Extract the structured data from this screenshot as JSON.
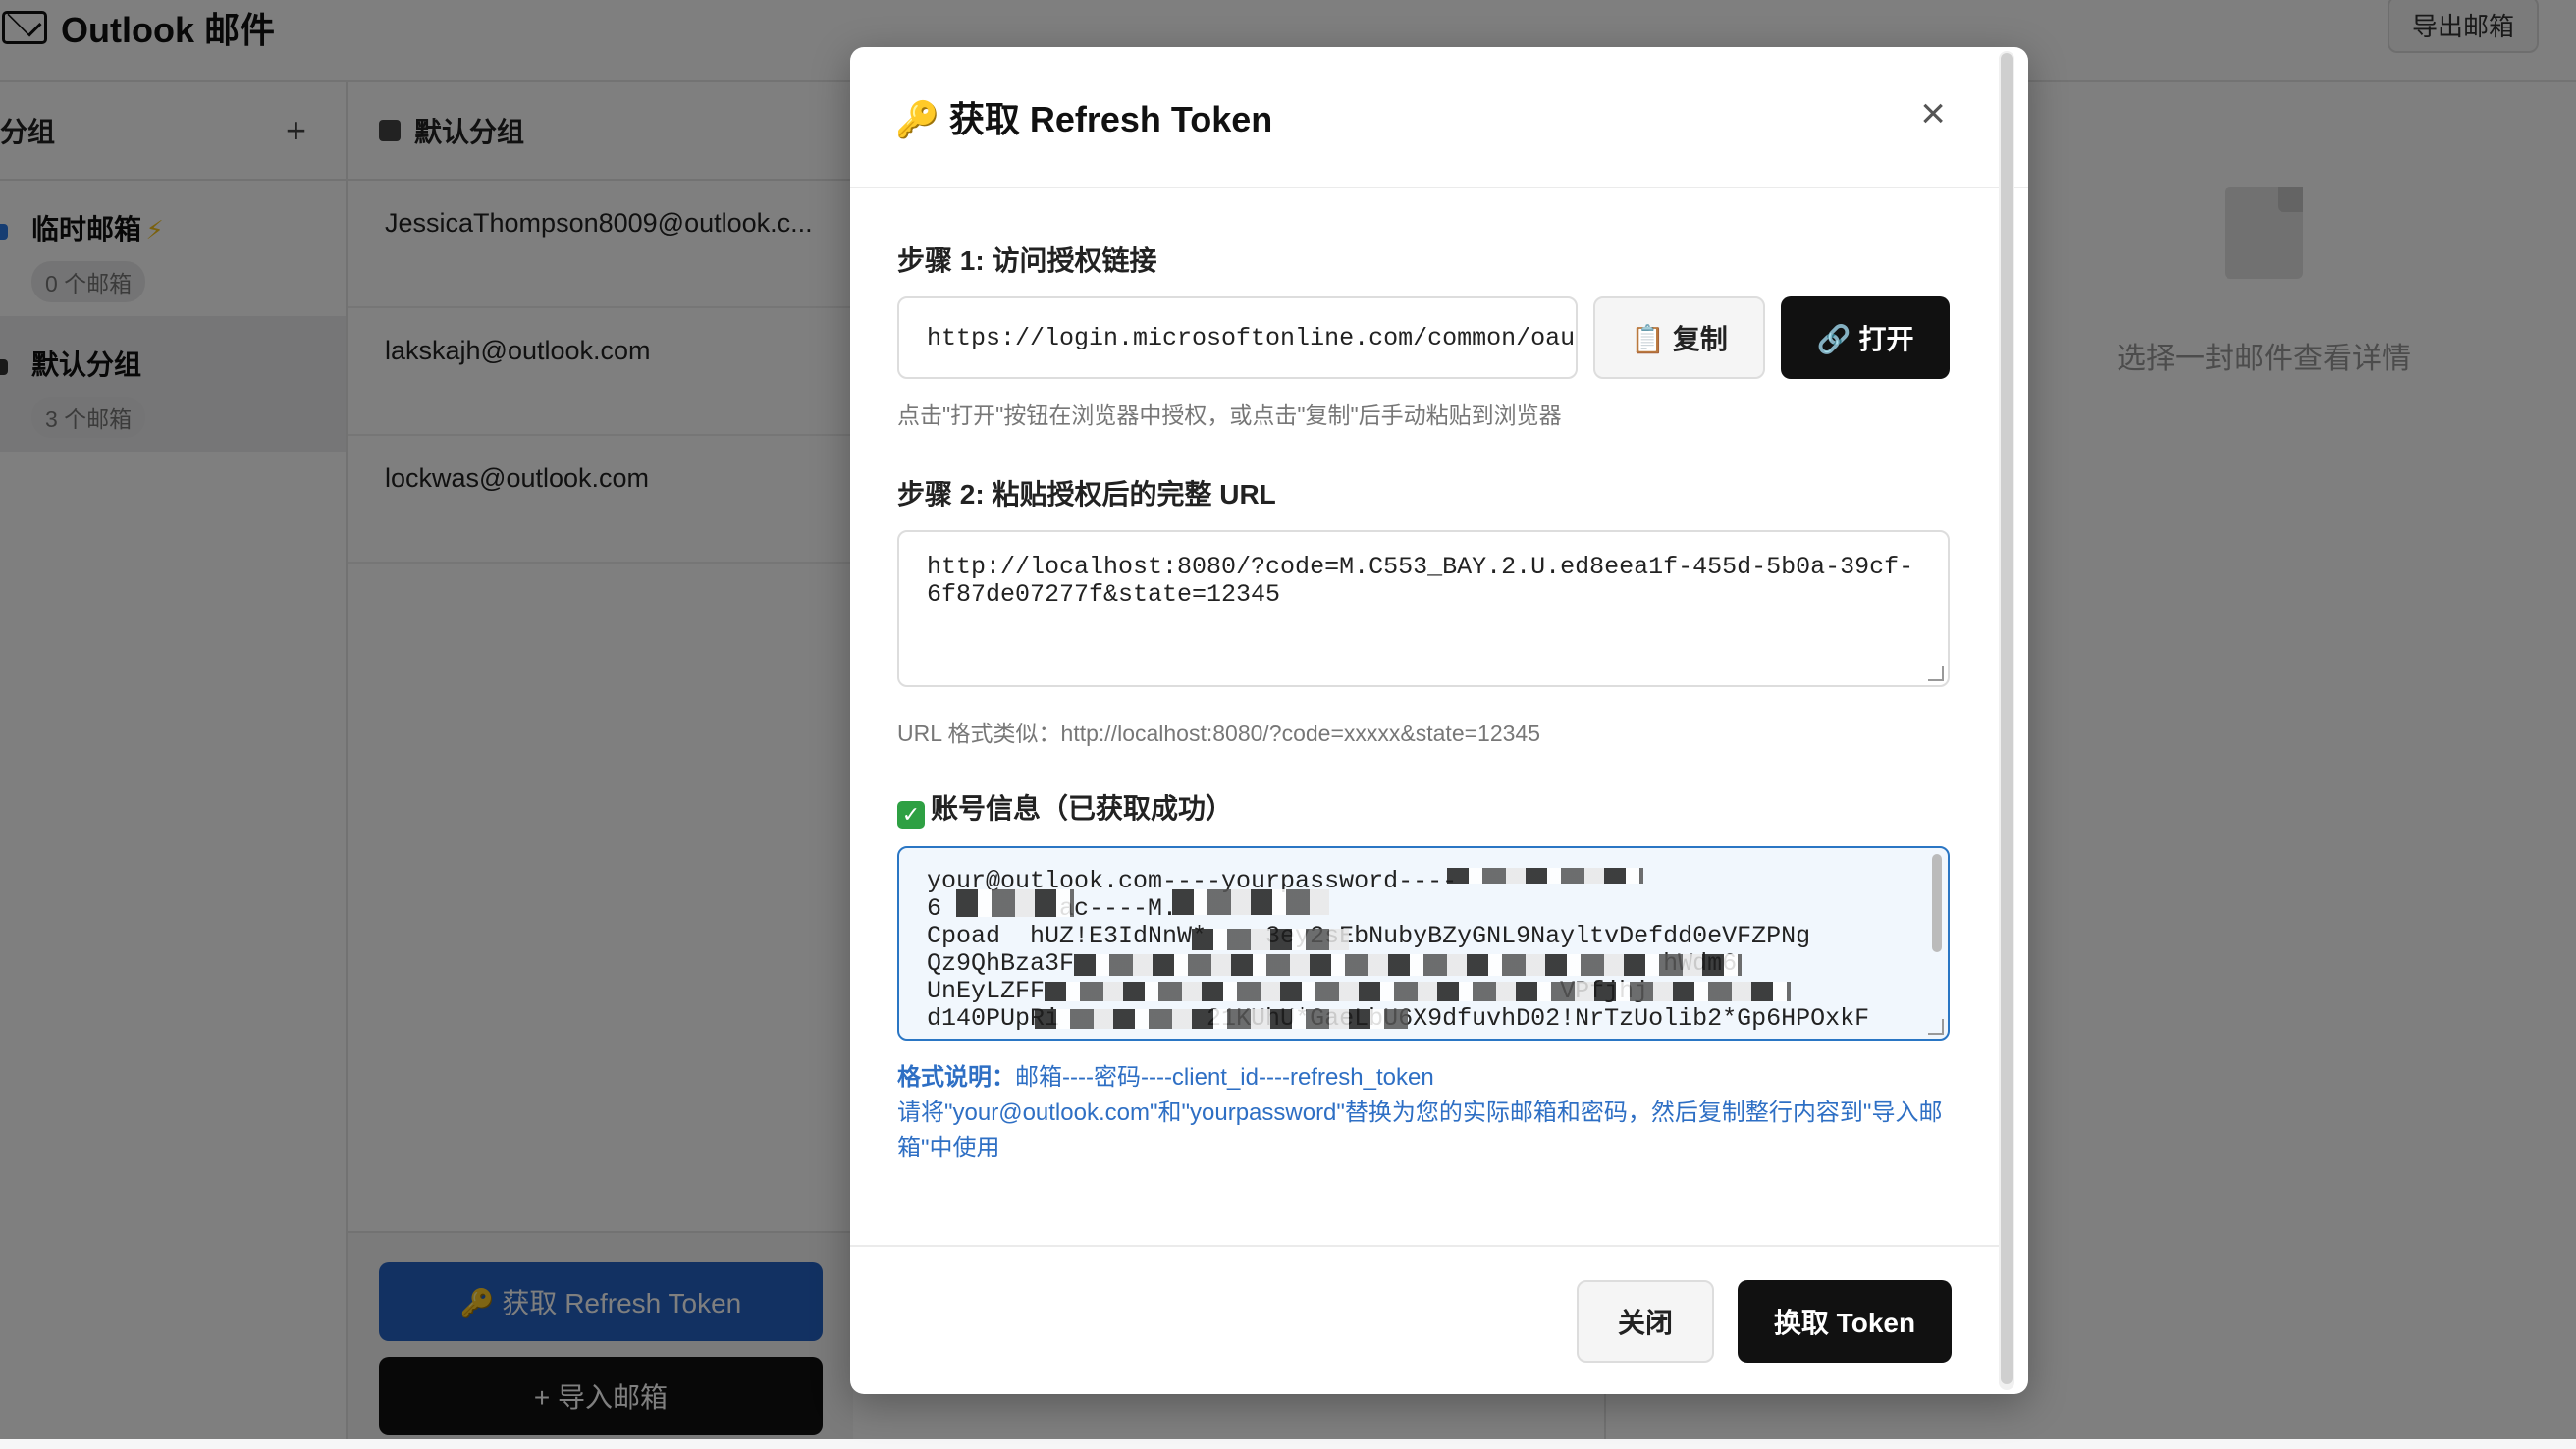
{
  "app": {
    "title": "Outlook 邮件",
    "export_label": "导出邮箱"
  },
  "groups": {
    "header": "分组",
    "add_icon": "plus-icon",
    "items": [
      {
        "name": "临时邮箱",
        "count": "0 个邮箱",
        "color": "#2c7be5",
        "badge_icon": "lightning-icon"
      },
      {
        "name": "默认分组",
        "count": "3 个邮箱",
        "color": "#333333"
      }
    ]
  },
  "emails": {
    "header": "默认分组",
    "items": [
      "JessicaThompson8009@outlook.c...",
      "lakskajh@outlook.com",
      "lockwas@outlook.com"
    ],
    "refresh_button": "🔑 获取 Refresh Token",
    "import_button": "+ 导入邮箱"
  },
  "detail": {
    "empty_text": "选择一封邮件查看详情"
  },
  "modal": {
    "title": "🔑 获取 Refresh Token",
    "close_icon": "close-icon",
    "step1": {
      "label": "步骤 1: 访问授权链接",
      "url": "https://login.microsoftonline.com/common/oau",
      "copy_label": "📋 复制",
      "open_label": "🔗 打开",
      "hint": "点击\"打开\"按钮在浏览器中授权，或点击\"复制\"后手动粘贴到浏览器"
    },
    "step2": {
      "label": "步骤 2: 粘贴授权后的完整 URL",
      "value": "http://localhost:8080/?code=M.C553_BAY.2.U.ed8eea1f-455d-5b0a-39cf-6f87de07277f&state=12345",
      "hint": "URL 格式类似：http://localhost:8080/?code=xxxxx&state=12345"
    },
    "account": {
      "label": "账号信息（已获取成功）",
      "text": "your@outlook.com----yourpassword----\n6        ac----M.\nCpoad  hUZ!E3IdNnW*    3ey2sEbNubyBZyGNL9NayltvDefdd0eVFZPNg\nQz9QhBza3F                                        hWdm6\nUnEyLZFF                                   VPfjhj\nd140PUpRi          21KUhU*GaeLbU6X9dfuvhD02!NrTzUolib2*Gp6HPOxkF",
      "format_label": "格式说明：",
      "format_text": "邮箱----密码----client_id----refresh_token",
      "note": "请将\"your@outlook.com\"和\"yourpassword\"替换为您的实际邮箱和密码，然后复制整行内容到\"导入邮箱\"中使用"
    },
    "footer": {
      "close_label": "关闭",
      "exchange_label": "换取 Token"
    }
  }
}
